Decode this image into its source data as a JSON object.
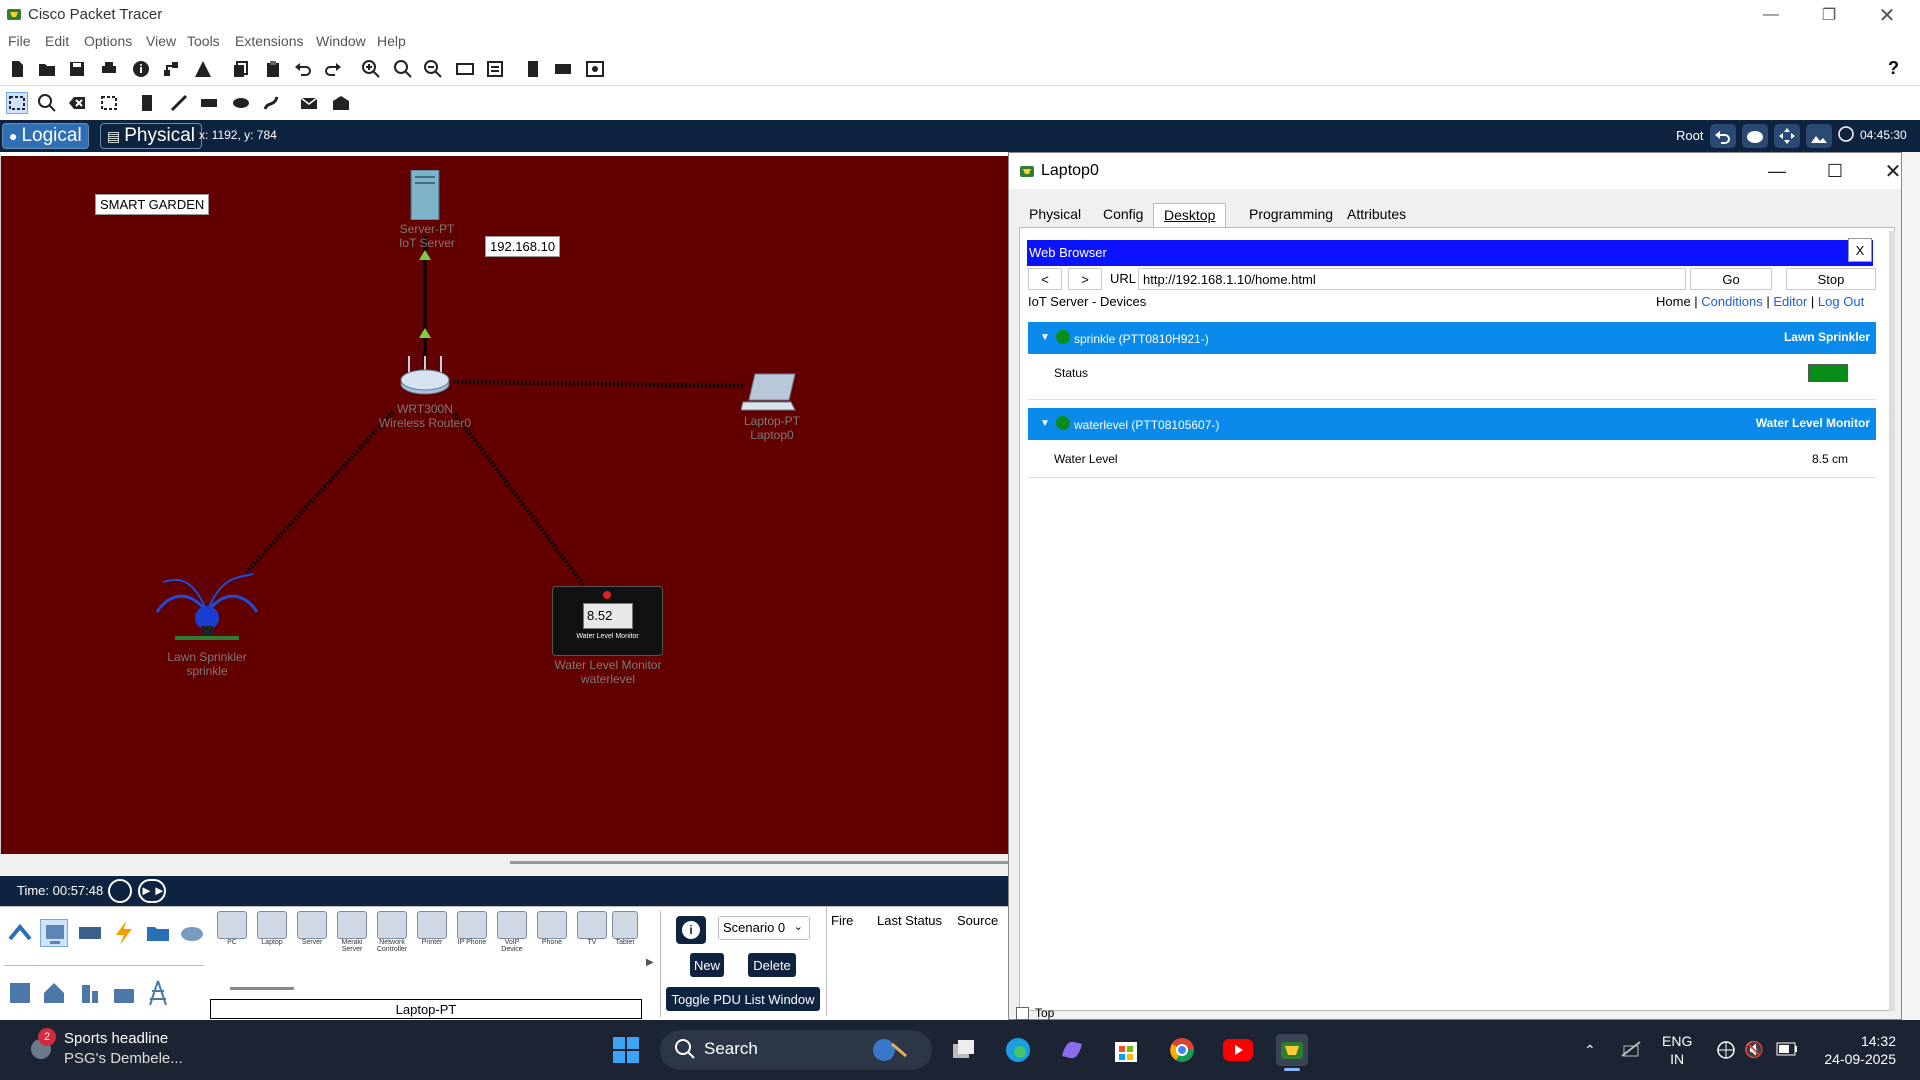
{
  "window": {
    "title": "Cisco Packet Tracer"
  },
  "menu": [
    "File",
    "Edit",
    "Options",
    "View",
    "Tools",
    "Extensions",
    "Window",
    "Help"
  ],
  "modebar": {
    "logical_label": "Logical",
    "physical_label": "Physical",
    "coordinates": "x: 1192, y: 784",
    "root_label": "Root",
    "clock": "04:45:30"
  },
  "workspace": {
    "title_note": "SMART GARDEN",
    "ip_note": "192.168.10",
    "devices": [
      {
        "line1": "Server-PT",
        "line2": "IoT Server"
      },
      {
        "line1": "WRT300N",
        "line2": "Wireless Router0"
      },
      {
        "line1": "Laptop-PT",
        "line2": "Laptop0"
      },
      {
        "line1": "Lawn Sprinkler",
        "line2": "sprinkle"
      },
      {
        "line1": "Water Level Monitor",
        "line2": "waterlevel"
      }
    ],
    "monitor_reading": "8.52",
    "monitor_caption": "Water Level Monitor"
  },
  "bottom": {
    "time": "Time: 00:57:48",
    "device_types": [
      "PC",
      "Laptop",
      "Server",
      "Meraki Server",
      "Network Controller",
      "Printer",
      "IP Phone",
      "VoIP Device",
      "Phone",
      "TV",
      "Tablet"
    ],
    "selected_device": "Laptop-PT",
    "scenario": "Scenario 0",
    "new_label": "New",
    "delete_label": "Delete",
    "toggle_label": "Toggle PDU List Window",
    "pdu_columns": [
      "Fire",
      "Last Status",
      "Source"
    ]
  },
  "laptop_window": {
    "title": "Laptop0",
    "tabs": [
      "Physical",
      "Config",
      "Desktop",
      "Programming",
      "Attributes"
    ],
    "active_tab": "Desktop",
    "browser": {
      "header": "Web Browser",
      "close_label": "X",
      "back_label": "<",
      "forward_label": ">",
      "url_label": "URL",
      "url": "http://192.168.1.10/home.html",
      "go_label": "Go",
      "stop_label": "Stop",
      "page_title": "IoT Server - Devices",
      "links": {
        "home": "Home",
        "conditions": "Conditions",
        "editor": "Editor",
        "logout": "Log Out"
      },
      "devices": [
        {
          "name": "sprinkle (PTT0810H921-)",
          "type": "Lawn Sprinkler",
          "field": "Status",
          "value": "",
          "status_color": "#0a8c1a"
        },
        {
          "name": "waterlevel (PTT08105607-)",
          "type": "Water Level Monitor",
          "field": "Water Level",
          "value": "8.5 cm"
        }
      ]
    },
    "top_checkbox": "Top"
  },
  "taskbar": {
    "news_badge": "2",
    "news_headline": "Sports headline",
    "news_sub": "PSG's Dembele...",
    "search_placeholder": "Search",
    "lang_line1": "ENG",
    "lang_line2": "IN",
    "time": "14:32",
    "date": "24-09-2025"
  }
}
